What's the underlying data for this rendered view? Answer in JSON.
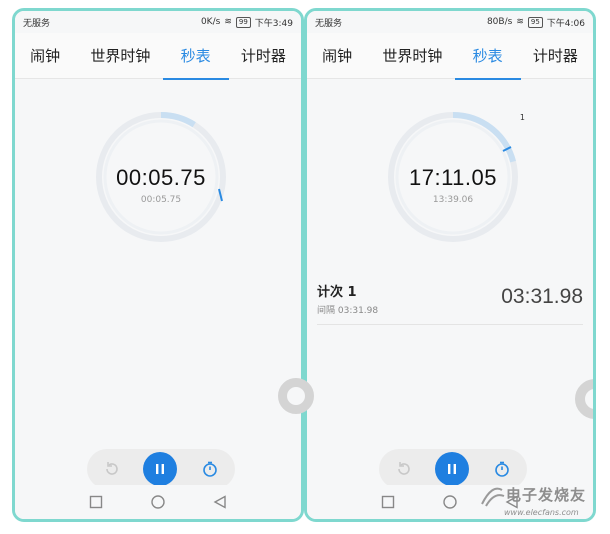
{
  "colors": {
    "accent": "#2a8ae2",
    "pause_button": "#1f7fe0",
    "frame_border": "#7fd8cf"
  },
  "tabs": [
    "闹钟",
    "世界时钟",
    "秒表",
    "计时器"
  ],
  "left": {
    "status": {
      "carrier": "无服务",
      "speed": "0K/s",
      "battery": "99",
      "time": "下午3:49"
    },
    "active_tab": 2,
    "stopwatch": {
      "main": "00:05.75",
      "sub": "00:05.75",
      "progress_fraction": 0.09
    },
    "controls": {
      "reset_icon": "reset-icon",
      "pause_icon": "pause-icon",
      "lap_icon": "stopwatch-icon"
    }
  },
  "right": {
    "status": {
      "carrier": "无服务",
      "speed": "80B/s",
      "battery": "95",
      "time": "下午4:06"
    },
    "active_tab": 2,
    "stopwatch": {
      "main": "17:11.05",
      "sub": "13:39.06",
      "lap_count": "1",
      "progress_fraction": 0.21
    },
    "lap": {
      "title": "计次 1",
      "split": "间隔 03:31.98",
      "time": "03:31.98"
    },
    "controls": {
      "reset_icon": "reset-icon",
      "pause_icon": "pause-icon",
      "lap_icon": "stopwatch-icon"
    }
  },
  "watermark": {
    "title": "电子发烧友",
    "url": "www.elecfans.com"
  }
}
